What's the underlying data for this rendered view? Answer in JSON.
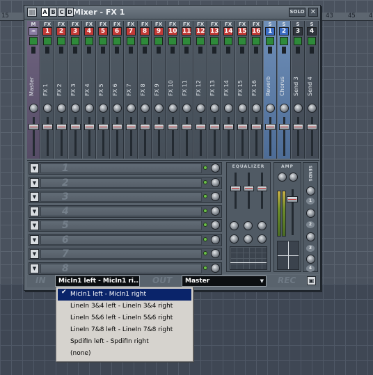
{
  "background": {
    "ruler_numbers": [
      "15",
      "43",
      "45",
      "4"
    ]
  },
  "window": {
    "title": "Mixer - FX 1",
    "icon_label": "|||",
    "tabs": [
      "A",
      "B",
      "C",
      "D"
    ],
    "solo_label": "SOLO",
    "close_label": "✕"
  },
  "channels": [
    {
      "top": "M",
      "num": "♒",
      "name": "Master",
      "kind": "master"
    },
    {
      "top": "FX",
      "num": "1",
      "name": "FX 1",
      "kind": "fx"
    },
    {
      "top": "FX",
      "num": "2",
      "name": "FX 2",
      "kind": "fx"
    },
    {
      "top": "FX",
      "num": "3",
      "name": "FX 3",
      "kind": "fx"
    },
    {
      "top": "FX",
      "num": "4",
      "name": "FX 4",
      "kind": "fx"
    },
    {
      "top": "FX",
      "num": "5",
      "name": "FX 5",
      "kind": "fx"
    },
    {
      "top": "FX",
      "num": "6",
      "name": "FX 6",
      "kind": "fx"
    },
    {
      "top": "FX",
      "num": "7",
      "name": "FX 7",
      "kind": "fx"
    },
    {
      "top": "FX",
      "num": "8",
      "name": "FX 8",
      "kind": "fx"
    },
    {
      "top": "FX",
      "num": "9",
      "name": "FX 9",
      "kind": "fx"
    },
    {
      "top": "FX",
      "num": "10",
      "name": "FX 10",
      "kind": "fx"
    },
    {
      "top": "FX",
      "num": "11",
      "name": "FX 11",
      "kind": "fx"
    },
    {
      "top": "FX",
      "num": "12",
      "name": "FX 12",
      "kind": "fx"
    },
    {
      "top": "FX",
      "num": "13",
      "name": "FX 13",
      "kind": "fx"
    },
    {
      "top": "FX",
      "num": "14",
      "name": "FX 14",
      "kind": "fx"
    },
    {
      "top": "FX",
      "num": "15",
      "name": "FX 15",
      "kind": "fx"
    },
    {
      "top": "FX",
      "num": "16",
      "name": "FX 16",
      "kind": "fx"
    },
    {
      "top": "S",
      "num": "1",
      "name": "Reverb",
      "kind": "send-active"
    },
    {
      "top": "S",
      "num": "2",
      "name": "Chorus",
      "kind": "send-active"
    },
    {
      "top": "S",
      "num": "3",
      "name": "Send 3",
      "kind": "send"
    },
    {
      "top": "S",
      "num": "4",
      "name": "Send 4",
      "kind": "send"
    }
  ],
  "slots": [
    "1",
    "2",
    "3",
    "4",
    "5",
    "6",
    "7",
    "8"
  ],
  "panels": {
    "equalizer_label": "EQUALIZER",
    "amp_label": "AMP",
    "sends_label": "SENDS",
    "send_numbers": [
      "1",
      "2",
      "3",
      "4"
    ]
  },
  "io": {
    "in_label": "IN",
    "out_label": "OUT",
    "rec_label": "REC",
    "input_value": "MicIn1 left - MicIn1 ri...",
    "output_value": "Master",
    "arrow": "▼",
    "disk_icon": "💾"
  },
  "menu": {
    "items": [
      "MicIn1 left - MicIn1 right",
      "LineIn 3&4 left - LineIn 3&4 right",
      "LineIn 5&6 left - LineIn 5&6 right",
      "LineIn 7&8 left - LineIn 7&8 right",
      "SpdifIn left - SpdifIn right",
      "(none)"
    ],
    "selected_index": 0,
    "check": "✔"
  }
}
